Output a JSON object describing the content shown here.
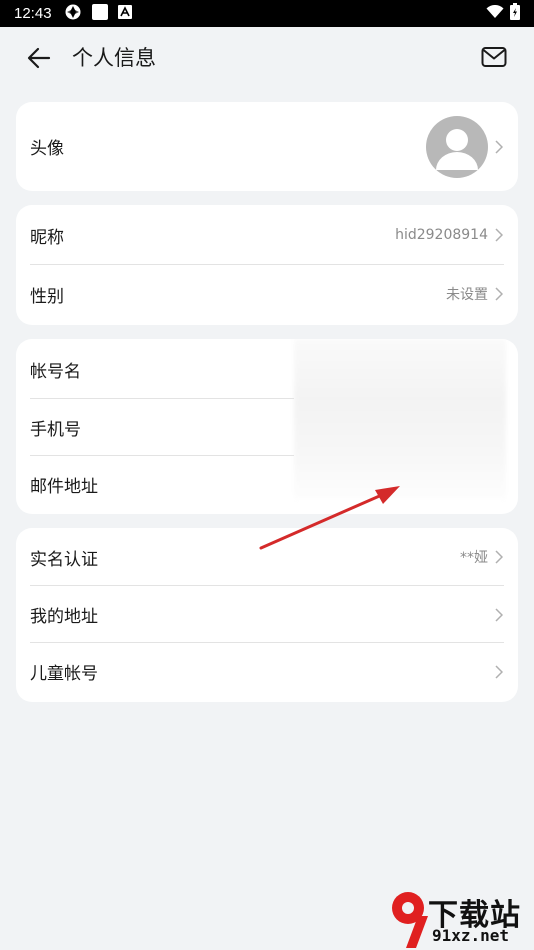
{
  "status_bar": {
    "time": "12:43"
  },
  "header": {
    "title": "个人信息"
  },
  "card_avatar": {
    "label": "头像"
  },
  "card_profile": {
    "nickname_label": "昵称",
    "nickname_value": "hid29208914",
    "gender_label": "性别",
    "gender_value": "未设置"
  },
  "card_account": {
    "account_name_label": "帐号名",
    "phone_label": "手机号",
    "email_label": "邮件地址"
  },
  "card_more": {
    "realname_label": "实名认证",
    "realname_value": "**娅",
    "address_label": "我的地址",
    "child_label": "儿童帐号"
  },
  "watermark": {
    "brand": "下载站",
    "url": "91xz.net"
  },
  "colors": {
    "background": "#f1f3f5",
    "card": "#ffffff",
    "arrow": "#d42a2a",
    "watermark_red": "#e02020"
  }
}
